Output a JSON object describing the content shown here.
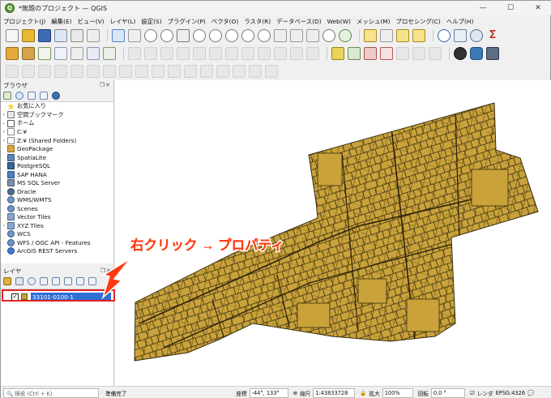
{
  "window": {
    "title": "*無題のプロジェクト — QGIS",
    "controls": [
      "—",
      "☐",
      "✕"
    ]
  },
  "menu": [
    "プロジェクト(J)",
    "編集(E)",
    "ビュー(V)",
    "レイヤ(L)",
    "設定(S)",
    "プラグイン(P)",
    "ベクタ(O)",
    "ラスタ(R)",
    "データベース(D)",
    "Web(W)",
    "メッシュ(M)",
    "プロセシング(C)",
    "ヘルプ(H)"
  ],
  "browser_panel": {
    "title": "ブラウザ",
    "controls": "❐✕",
    "items": [
      {
        "label": "お気に入り",
        "icon": "star-icon",
        "expand": ""
      },
      {
        "label": "空間ブックマーク",
        "icon": "bookmark-icon",
        "expand": "›"
      },
      {
        "label": "ホーム",
        "icon": "home-folder-icon",
        "expand": "›"
      },
      {
        "label": "C:¥",
        "icon": "drive-icon",
        "expand": "›"
      },
      {
        "label": "Z:¥ (Shared Folders)",
        "icon": "folder-icon",
        "expand": "›"
      },
      {
        "label": "GeoPackage",
        "icon": "geopackage-icon",
        "expand": ""
      },
      {
        "label": "SpatiaLite",
        "icon": "spatialite-icon",
        "expand": ""
      },
      {
        "label": "PostgreSQL",
        "icon": "postgresql-icon",
        "expand": ""
      },
      {
        "label": "SAP HANA",
        "icon": "sap-hana-icon",
        "expand": ""
      },
      {
        "label": "MS SQL Server",
        "icon": "mssql-icon",
        "expand": ""
      },
      {
        "label": "Oracle",
        "icon": "oracle-icon",
        "expand": ""
      },
      {
        "label": "WMS/WMTS",
        "icon": "wms-icon",
        "expand": ""
      },
      {
        "label": "Scenes",
        "icon": "scenes-icon",
        "expand": ""
      },
      {
        "label": "Vector Tiles",
        "icon": "vector-tiles-icon",
        "expand": ""
      },
      {
        "label": "XYZ Tiles",
        "icon": "xyz-tiles-icon",
        "expand": "›"
      },
      {
        "label": "WCS",
        "icon": "wcs-icon",
        "expand": ""
      },
      {
        "label": "WFS / OGC API - Features",
        "icon": "wfs-icon",
        "expand": ""
      },
      {
        "label": "ArcGIS REST Servers",
        "icon": "arcgis-icon",
        "expand": ""
      }
    ]
  },
  "layers_panel": {
    "title": "レイヤ",
    "controls": "❐✕",
    "layer": {
      "name": "33101-0100-1",
      "checked": "✓"
    }
  },
  "annotation": {
    "text": "右クリック → プロパティ",
    "color": "#ff3a10"
  },
  "map": {
    "fill_color": "#c9a23a",
    "stroke_color": "#3a2e10"
  },
  "status": {
    "search_placeholder": "🔍 検索 (Ctrl + K)",
    "ready": "準備完了",
    "coord_label": "座標",
    "coord_value": "-44°, 133°",
    "scale_label": "縮尺",
    "scale_value": "1:43833728",
    "magnifier_label": "拡大",
    "magnifier_value": "100%",
    "rotation_label": "回転",
    "rotation_value": "0.0 °",
    "render_label": "レンダ",
    "crs": "EPSG:4326"
  }
}
